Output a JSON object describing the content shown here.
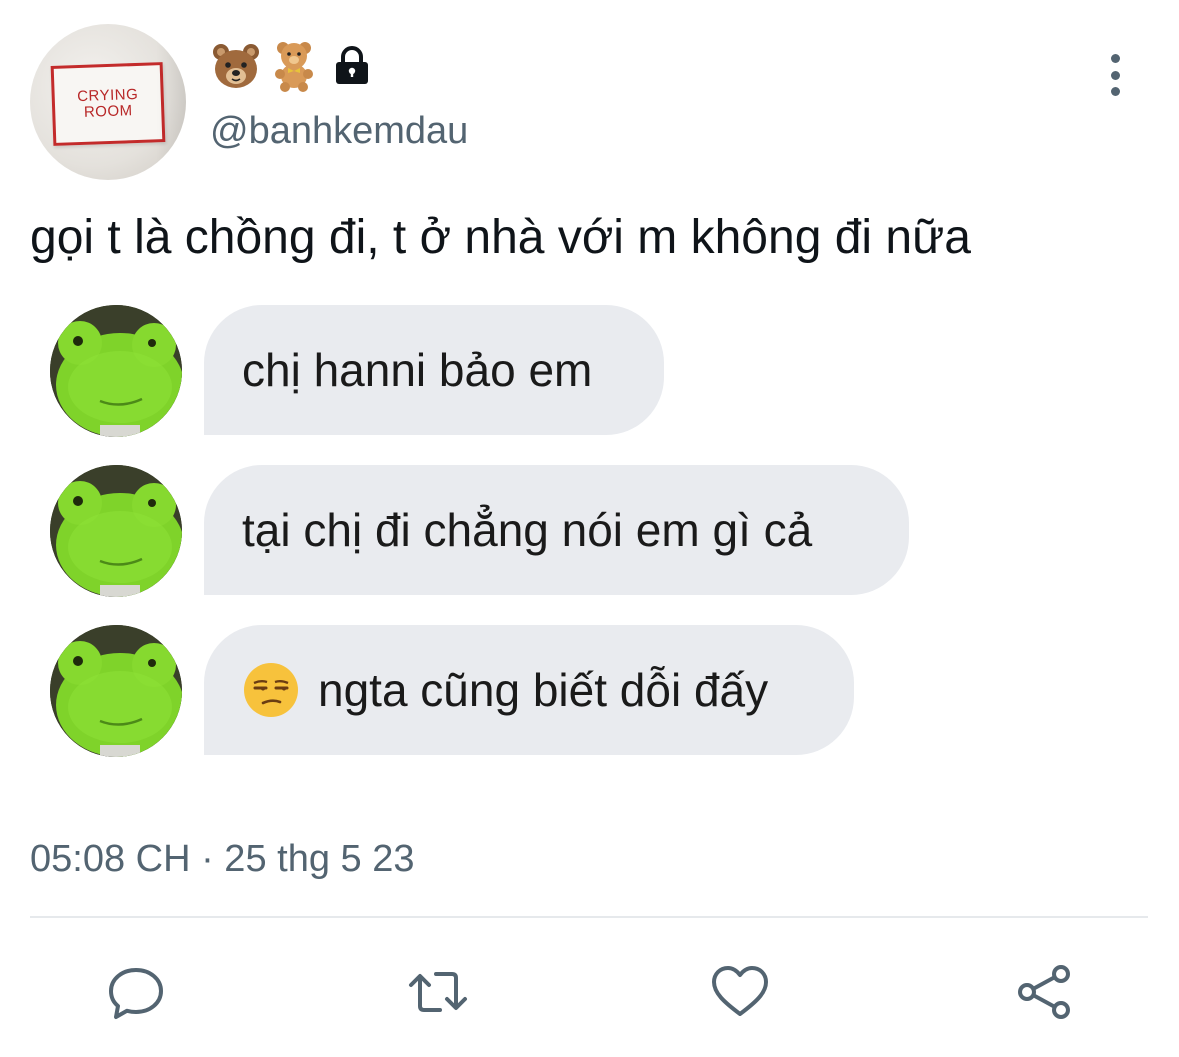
{
  "profile": {
    "avatar_sign_line1": "CRYING",
    "avatar_sign_line2": "ROOM",
    "name_emojis": [
      "bear-face-emoji",
      "teddy-bear-emoji"
    ],
    "protected_icon": "lock-icon",
    "handle": "@banhkemdau"
  },
  "tweet": {
    "text": "gọi t là chồng đi, t ở nhà với m không đi nữa"
  },
  "chat": {
    "avatar_icon": "green-frog-plush-avatar",
    "messages": [
      {
        "text": "chị hanni bảo em",
        "emoji": ""
      },
      {
        "text": "tại chị đi chẳng nói em gì cả",
        "emoji": ""
      },
      {
        "text": "ngta cũng biết dỗi đấy",
        "emoji": "unamused-face-emoji"
      }
    ]
  },
  "meta": {
    "timestamp": "05:08 CH · 25 thg 5 23"
  },
  "actions": {
    "reply_icon": "reply-icon",
    "retweet_icon": "retweet-icon",
    "like_icon": "heart-icon",
    "share_icon": "share-icon"
  },
  "colors": {
    "text_primary": "#0f1419",
    "text_secondary": "#536471",
    "bubble_bg": "#e9ebef",
    "sign_red": "#c32b2b"
  }
}
